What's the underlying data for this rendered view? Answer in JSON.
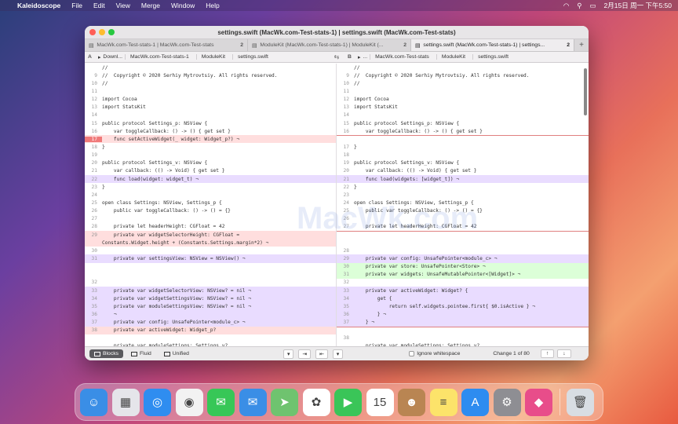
{
  "menubar": {
    "apple": "",
    "app": "Kaleidoscope",
    "items": [
      "File",
      "Edit",
      "View",
      "Merge",
      "Window",
      "Help"
    ],
    "clock": "2月15日 周一 下午5:50"
  },
  "window": {
    "title": "settings.swift (MacWk.com-Test-stats-1) | settings.swift (MacWk.com-Test-stats)",
    "tabs": [
      {
        "label": "MacWk.com-Test-stats-1 | MacWk.com-Test-stats",
        "count": "2"
      },
      {
        "label": "ModuleKit (MacWk.com-Test-stats-1) | ModuleKit (...",
        "count": "2"
      },
      {
        "label": "settings.swift (MacWk.com-Test-stats-1) | settings...",
        "count": "2"
      }
    ],
    "left_path": {
      "label": "A",
      "crumbs": [
        "Downl...",
        "MacWk.com-Test-stats-1",
        "ModuleKit",
        "settings.swift"
      ]
    },
    "right_path": {
      "label": "B",
      "crumbs": [
        "...",
        "MacWk.com-Test-stats",
        "ModuleKit",
        "settings.swift"
      ]
    }
  },
  "watermark": "MacWk.com",
  "left_lines": [
    {
      "n": "",
      "c": "//",
      "k": ""
    },
    {
      "n": "9",
      "c": "//  Copyright © 2020 Serhiy Mytrovtsiy. All rights reserved.",
      "k": ""
    },
    {
      "n": "10",
      "c": "//",
      "k": ""
    },
    {
      "n": "11",
      "c": "",
      "k": ""
    },
    {
      "n": "12",
      "c": "import Cocoa",
      "k": ""
    },
    {
      "n": "13",
      "c": "import StatsKit",
      "k": ""
    },
    {
      "n": "14",
      "c": "",
      "k": ""
    },
    {
      "n": "15",
      "c": "public protocol Settings_p: NSView {",
      "k": ""
    },
    {
      "n": "16",
      "c": "    var toggleCallback: () -> () { get set }",
      "k": ""
    },
    {
      "n": "17",
      "c": "    func setActiveWidget(_ widget: Widget_p?) ¬",
      "k": "del strong"
    },
    {
      "n": "18",
      "c": "}",
      "k": ""
    },
    {
      "n": "19",
      "c": "",
      "k": ""
    },
    {
      "n": "20",
      "c": "public protocol Settings_v: NSView {",
      "k": ""
    },
    {
      "n": "21",
      "c": "    var callback: (() -> Void) { get set }",
      "k": ""
    },
    {
      "n": "22",
      "c": "    func load(widget: widget_t) ¬",
      "k": "chg"
    },
    {
      "n": "23",
      "c": "}",
      "k": ""
    },
    {
      "n": "24",
      "c": "",
      "k": ""
    },
    {
      "n": "25",
      "c": "open class Settings: NSView, Settings_p {",
      "k": ""
    },
    {
      "n": "26",
      "c": "    public var toggleCallback: () -> () = {}",
      "k": ""
    },
    {
      "n": "27",
      "c": "",
      "k": ""
    },
    {
      "n": "28",
      "c": "    private let headerHeight: CGFloat = 42",
      "k": ""
    },
    {
      "n": "29",
      "c": "    private var widgetSelectorHeight: CGFloat =",
      "k": "del"
    },
    {
      "n": "",
      "c": "Constants.Widget.height + (Constants.Settings.margin*2) ¬",
      "k": "del"
    },
    {
      "n": "30",
      "c": "",
      "k": ""
    },
    {
      "n": "31",
      "c": "    private var settingsView: NSView = NSView() ¬",
      "k": "chg"
    },
    {
      "n": "",
      "c": "",
      "k": ""
    },
    {
      "n": "",
      "c": "",
      "k": ""
    },
    {
      "n": "32",
      "c": "",
      "k": ""
    },
    {
      "n": "33",
      "c": "    private var widgetSelectorView: NSView? = nil ¬",
      "k": "chg"
    },
    {
      "n": "34",
      "c": "    private var widgetSettingsView: NSView? = nil ¬",
      "k": "chg"
    },
    {
      "n": "35",
      "c": "    private var moduleSettingsView: NSView? = nil ¬",
      "k": "chg"
    },
    {
      "n": "36",
      "c": "    ¬",
      "k": "chg"
    },
    {
      "n": "37",
      "c": "    private var config: UnsafePointer<module_c> ¬",
      "k": "chg"
    },
    {
      "n": "38",
      "c": "    private var activeWidget: Widget_p?",
      "k": "del"
    },
    {
      "n": "",
      "c": "",
      "k": ""
    },
    {
      "n": "",
      "c": "    private var moduleSettings: Settings_v?",
      "k": ""
    }
  ],
  "right_lines": [
    {
      "n": "",
      "c": "//",
      "k": ""
    },
    {
      "n": "9",
      "c": "//  Copyright © 2020 Serhiy Mytrovtsiy. All rights reserved.",
      "k": ""
    },
    {
      "n": "10",
      "c": "//",
      "k": ""
    },
    {
      "n": "11",
      "c": "",
      "k": ""
    },
    {
      "n": "12",
      "c": "import Cocoa",
      "k": ""
    },
    {
      "n": "13",
      "c": "import StatsKit",
      "k": ""
    },
    {
      "n": "14",
      "c": "",
      "k": ""
    },
    {
      "n": "15",
      "c": "public protocol Settings_p: NSView {",
      "k": ""
    },
    {
      "n": "16",
      "c": "    var toggleCallback: () -> () { get set }",
      "k": ""
    },
    {
      "n": "",
      "c": "",
      "k": "sep"
    },
    {
      "n": "17",
      "c": "}",
      "k": ""
    },
    {
      "n": "18",
      "c": "",
      "k": ""
    },
    {
      "n": "19",
      "c": "public protocol Settings_v: NSView {",
      "k": ""
    },
    {
      "n": "20",
      "c": "    var callback: (() -> Void) { get set }",
      "k": ""
    },
    {
      "n": "21",
      "c": "    func load(widgets: [widget_t]) ¬",
      "k": "chg"
    },
    {
      "n": "22",
      "c": "}",
      "k": ""
    },
    {
      "n": "23",
      "c": "",
      "k": ""
    },
    {
      "n": "24",
      "c": "open class Settings: NSView, Settings_p {",
      "k": ""
    },
    {
      "n": "25",
      "c": "    public var toggleCallback: () -> () = {}",
      "k": ""
    },
    {
      "n": "26",
      "c": "",
      "k": ""
    },
    {
      "n": "27",
      "c": "    private let headerHeight: CGFloat = 42",
      "k": ""
    },
    {
      "n": "",
      "c": "",
      "k": "sep"
    },
    {
      "n": "",
      "c": "",
      "k": ""
    },
    {
      "n": "28",
      "c": "",
      "k": ""
    },
    {
      "n": "29",
      "c": "    private var config: UnsafePointer<module_c> ¬",
      "k": "chg"
    },
    {
      "n": "30",
      "c": "    private var store: UnsafePointer<Store> ¬",
      "k": "add"
    },
    {
      "n": "31",
      "c": "    private var widgets: UnsafeMutablePointer<[Widget]> ¬",
      "k": "add"
    },
    {
      "n": "32",
      "c": "",
      "k": ""
    },
    {
      "n": "33",
      "c": "    private var activeWidget: Widget? {",
      "k": "chg"
    },
    {
      "n": "34",
      "c": "        get {",
      "k": "chg"
    },
    {
      "n": "35",
      "c": "            return self.widgets.pointee.first{ $0.isActive } ¬",
      "k": "chg"
    },
    {
      "n": "36",
      "c": "        } ¬",
      "k": "chg"
    },
    {
      "n": "37",
      "c": "    } ¬",
      "k": "chg"
    },
    {
      "n": "",
      "c": "",
      "k": "sep"
    },
    {
      "n": "38",
      "c": "",
      "k": ""
    },
    {
      "n": "",
      "c": "    private var moduleSettings: Settings_v?",
      "k": ""
    }
  ],
  "statusbar": {
    "blocks": "Blocks",
    "fluid": "Fluid",
    "unified": "Unified",
    "ignore_ws": "Ignore whitespace",
    "change": "Change 1 of 80"
  },
  "dock": {
    "icons": [
      {
        "name": "finder-icon",
        "color": "#3a8ee6",
        "glyph": "☺"
      },
      {
        "name": "launchpad-icon",
        "color": "#e5e5ea",
        "glyph": "▦"
      },
      {
        "name": "safari-icon",
        "color": "#2f8df0",
        "glyph": "◎"
      },
      {
        "name": "chrome-icon",
        "color": "#f2f2f2",
        "glyph": "◉"
      },
      {
        "name": "messages-icon",
        "color": "#37c757",
        "glyph": "✉"
      },
      {
        "name": "mail-icon",
        "color": "#3a8ee6",
        "glyph": "✉"
      },
      {
        "name": "maps-icon",
        "color": "#6fc36f",
        "glyph": "➤"
      },
      {
        "name": "photos-icon",
        "color": "#ffffff",
        "glyph": "✿"
      },
      {
        "name": "facetime-icon",
        "color": "#3ac558",
        "glyph": "▶"
      },
      {
        "name": "calendar-icon",
        "color": "#ffffff",
        "glyph": "15"
      },
      {
        "name": "contacts-icon",
        "color": "#b98552",
        "glyph": "☻"
      },
      {
        "name": "notes-icon",
        "color": "#fce36a",
        "glyph": "≡"
      },
      {
        "name": "app-store-icon",
        "color": "#2d8cf0",
        "glyph": "A"
      },
      {
        "name": "system-preferences-icon",
        "color": "#8e8e93",
        "glyph": "⚙"
      },
      {
        "name": "kaleidoscope-icon",
        "color": "#e84d8a",
        "glyph": "◆"
      },
      {
        "name": "trash-icon",
        "color": "#d8dde3",
        "glyph": "🗑"
      }
    ]
  }
}
